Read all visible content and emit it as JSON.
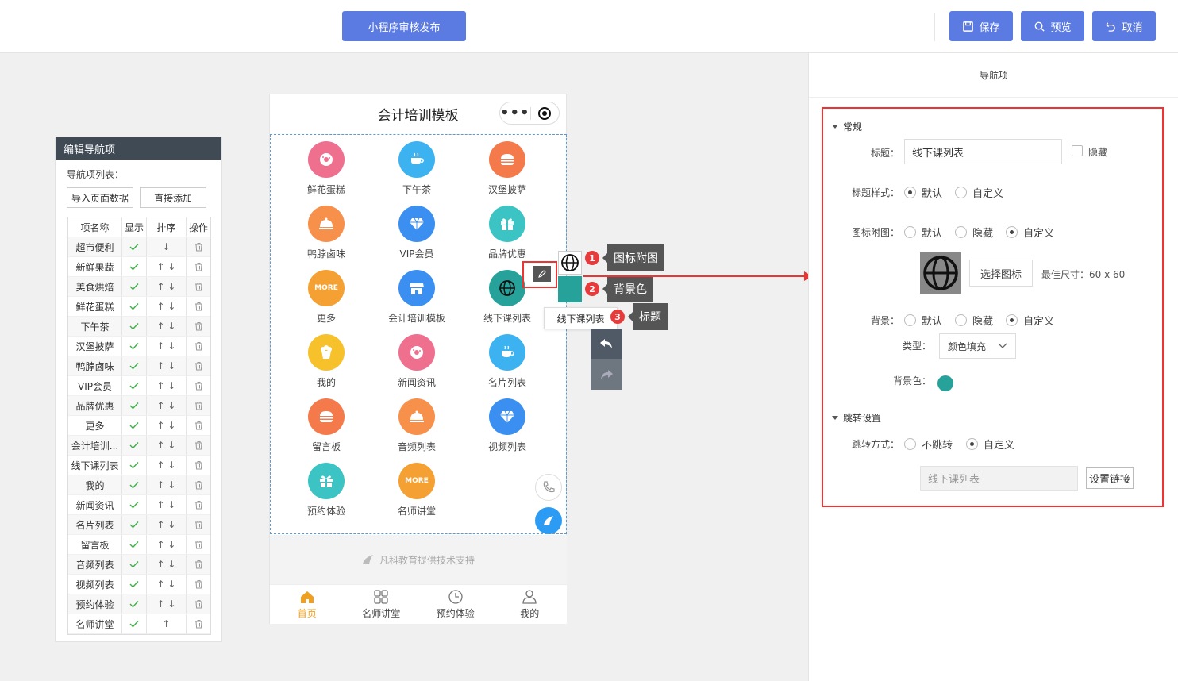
{
  "topbar": {
    "publish_label": "小程序审核发布",
    "save_label": "保存",
    "preview_label": "预览",
    "cancel_label": "取消",
    "accent_color": "#5b7be3"
  },
  "left_panel": {
    "title": "编辑导航项",
    "list_label": "导航项列表：",
    "import_label": "导入页面数据",
    "add_label": "直接添加",
    "columns": [
      "项名称",
      "显示",
      "排序",
      "操作"
    ],
    "rows": [
      {
        "name": "超市便利",
        "sort": "↓"
      },
      {
        "name": "新鲜果蔬",
        "sort": "↑ ↓"
      },
      {
        "name": "美食烘焙",
        "sort": "↑ ↓"
      },
      {
        "name": "鲜花蛋糕",
        "sort": "↑ ↓"
      },
      {
        "name": "下午茶",
        "sort": "↑ ↓"
      },
      {
        "name": "汉堡披萨",
        "sort": "↑ ↓"
      },
      {
        "name": "鸭脖卤味",
        "sort": "↑ ↓"
      },
      {
        "name": "VIP会员",
        "sort": "↑ ↓"
      },
      {
        "name": "品牌优惠",
        "sort": "↑ ↓"
      },
      {
        "name": "更多",
        "sort": "↑ ↓"
      },
      {
        "name": "会计培训...",
        "sort": "↑ ↓"
      },
      {
        "name": "线下课列表",
        "sort": "↑ ↓"
      },
      {
        "name": "我的",
        "sort": "↑ ↓"
      },
      {
        "name": "新闻资讯",
        "sort": "↑ ↓"
      },
      {
        "name": "名片列表",
        "sort": "↑ ↓"
      },
      {
        "name": "留言板",
        "sort": "↑ ↓"
      },
      {
        "name": "音频列表",
        "sort": "↑ ↓"
      },
      {
        "name": "视频列表",
        "sort": "↑ ↓"
      },
      {
        "name": "预约体验",
        "sort": "↑ ↓"
      },
      {
        "name": "名师讲堂",
        "sort": "↑"
      }
    ]
  },
  "phone": {
    "title": "会计培训模板",
    "grid": [
      {
        "label": "鲜花蛋糕",
        "icon": "donut-icon",
        "color": "#ef6f8e",
        "text": ""
      },
      {
        "label": "下午茶",
        "icon": "coffee-icon",
        "color": "#3cb3f0",
        "text": ""
      },
      {
        "label": "汉堡披萨",
        "icon": "burger-icon",
        "color": "#f47a4b",
        "text": ""
      },
      {
        "label": "鸭脖卤味",
        "icon": "cloche-icon",
        "color": "#f7904a",
        "text": ""
      },
      {
        "label": "VIP会员",
        "icon": "diamond-icon",
        "color": "#3b8ff0",
        "text": ""
      },
      {
        "label": "品牌优惠",
        "icon": "gift-icon",
        "color": "#3cc4c4",
        "text": ""
      },
      {
        "label": "更多",
        "icon": "more-icon",
        "color": "#f5a033",
        "text": "MORE"
      },
      {
        "label": "会计培训模板",
        "icon": "store-icon",
        "color": "#3b8ff0",
        "text": ""
      },
      {
        "label": "线下课列表",
        "icon": "globe-icon",
        "color": "#26a29b",
        "text": ""
      },
      {
        "label": "我的",
        "icon": "popcorn-icon",
        "color": "#f7c12c",
        "text": ""
      },
      {
        "label": "新闻资讯",
        "icon": "donut-icon",
        "color": "#ef6f8e",
        "text": ""
      },
      {
        "label": "名片列表",
        "icon": "coffee-icon",
        "color": "#3cb3f0",
        "text": ""
      },
      {
        "label": "留言板",
        "icon": "burger-icon",
        "color": "#f47a4b",
        "text": ""
      },
      {
        "label": "音频列表",
        "icon": "cloche-icon",
        "color": "#f7904a",
        "text": ""
      },
      {
        "label": "视频列表",
        "icon": "diamond-icon",
        "color": "#3b8ff0",
        "text": ""
      },
      {
        "label": "预约体验",
        "icon": "gift-icon",
        "color": "#3cc4c4",
        "text": ""
      },
      {
        "label": "名师讲堂",
        "icon": "more-icon",
        "color": "#f5a033",
        "text": "MORE"
      }
    ],
    "footer_note": "凡科教育提供技术支持",
    "tabs": [
      {
        "label": "首页",
        "icon": "home-icon"
      },
      {
        "label": "名师讲堂",
        "icon": "grid-icon"
      },
      {
        "label": "预约体验",
        "icon": "clock-icon"
      },
      {
        "label": "我的",
        "icon": "user-icon"
      }
    ],
    "active_tab": 0
  },
  "toolbox": {
    "title_chip": "线下课列表",
    "tips": [
      {
        "num": "1",
        "label": "图标附图"
      },
      {
        "num": "2",
        "label": "背景色"
      },
      {
        "num": "3",
        "label": "标题"
      }
    ],
    "bg_color": "#26a29b"
  },
  "right_panel": {
    "header": "导航项",
    "general": {
      "section": "常规",
      "title_label": "标题：",
      "title_value": "线下课列表",
      "hide_label": "隐藏",
      "title_style_label": "标题样式：",
      "title_style_opts": [
        "默认",
        "自定义"
      ],
      "icon_label": "图标附图：",
      "icon_opts": [
        "默认",
        "隐藏",
        "自定义"
      ],
      "choose_icon": "选择图标",
      "best_size": "最佳尺寸：60 x 60",
      "bg_label": "背景：",
      "bg_opts": [
        "默认",
        "隐藏",
        "自定义"
      ],
      "type_label": "类型：",
      "type_value": "颜色填充",
      "bg_color_label": "背景色：",
      "bg_color": "#26a29b"
    },
    "jump": {
      "section": "跳转设置",
      "mode_label": "跳转方式：",
      "mode_opts": [
        "不跳转",
        "自定义"
      ],
      "link_value": "线下课列表",
      "link_btn": "设置链接"
    }
  }
}
